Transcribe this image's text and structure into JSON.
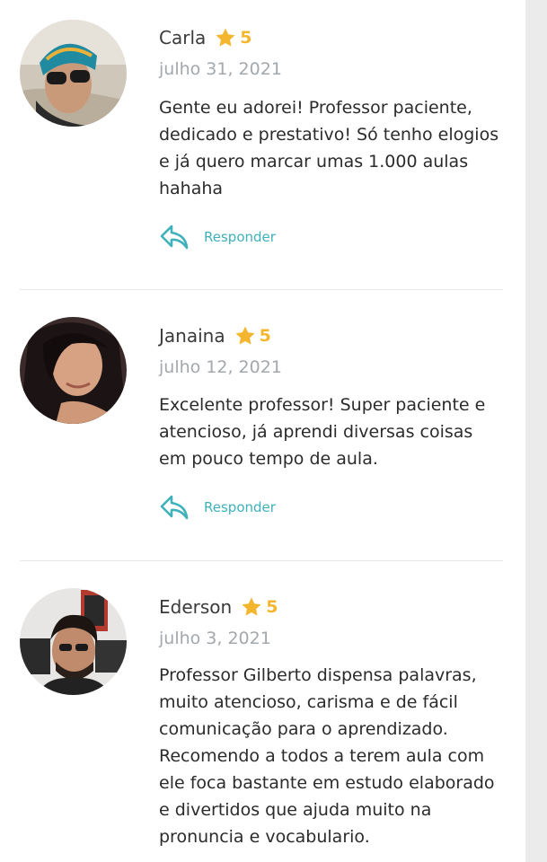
{
  "reviews": [
    {
      "name": "Carla",
      "rating": "5",
      "date": "julho 31, 2021",
      "text": "Gente eu adorei! Professor paciente, dedicado e prestativo! Só tenho elogios e já quero marcar umas 1.000 aulas hahaha",
      "reply_label": "Responder"
    },
    {
      "name": "Janaina",
      "rating": "5",
      "date": "julho 12, 2021",
      "text": "Excelente professor! Super paciente e atencioso, já aprendi diversas coisas em pouco tempo de aula.",
      "reply_label": "Responder"
    },
    {
      "name": "Ederson",
      "rating": "5",
      "date": "julho 3, 2021",
      "text": "Professor Gilberto dispensa palavras, muito atencioso, carisma e de fácil comunicação para o aprendizado. Recomendo a todos a terem aula com ele foca bastante em estudo elaborado e divertidos que ajuda muito na pronuncia e vocabulario."
    }
  ],
  "icons": {
    "star": "star-icon",
    "reply": "reply-arrow-icon"
  },
  "colors": {
    "star": "#f4b62e",
    "reply": "#3fb1ba",
    "date": "#a3a8ad",
    "divider": "#e7e7e7"
  }
}
